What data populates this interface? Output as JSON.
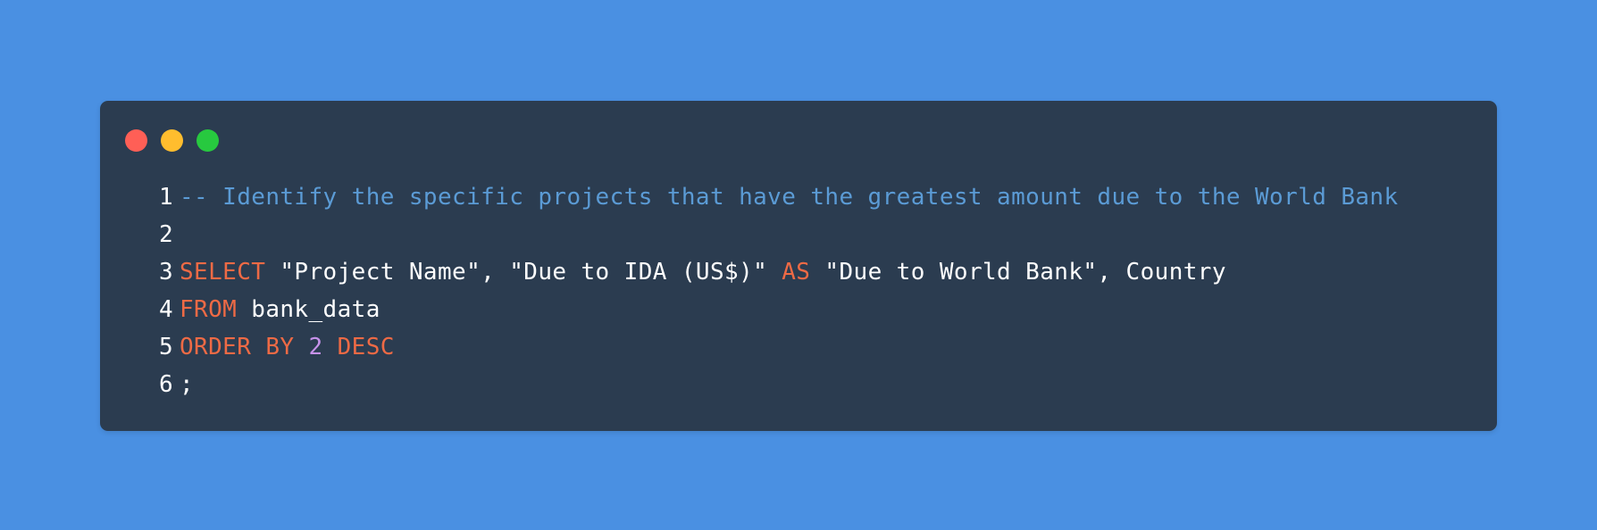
{
  "window": {
    "buttons": [
      "close-icon",
      "minimize-icon",
      "maximize-icon"
    ],
    "colors": {
      "background": "#4a90e2",
      "window": "#2b3c50",
      "close": "#ff5f56",
      "minimize": "#ffbd2e",
      "maximize": "#27c93f",
      "comment": "#5b9bd5",
      "keyword": "#ee6a45",
      "number": "#c792ea",
      "text": "#ffffff"
    }
  },
  "code": {
    "language": "sql",
    "lines": [
      {
        "num": "1",
        "tokens": [
          {
            "type": "comment",
            "text": "-- Identify the specific projects that have the greatest amount due to the World Bank"
          }
        ]
      },
      {
        "num": "2",
        "tokens": []
      },
      {
        "num": "3",
        "tokens": [
          {
            "type": "keyword",
            "text": "SELECT"
          },
          {
            "type": "text",
            "text": " \"Project Name\", \"Due to IDA (US$)\" "
          },
          {
            "type": "keyword",
            "text": "AS"
          },
          {
            "type": "text",
            "text": " \"Due to World Bank\", Country"
          }
        ]
      },
      {
        "num": "4",
        "tokens": [
          {
            "type": "keyword",
            "text": "FROM"
          },
          {
            "type": "text",
            "text": " bank_data"
          }
        ]
      },
      {
        "num": "5",
        "tokens": [
          {
            "type": "keyword",
            "text": "ORDER BY"
          },
          {
            "type": "text",
            "text": " "
          },
          {
            "type": "number",
            "text": "2"
          },
          {
            "type": "text",
            "text": " "
          },
          {
            "type": "keyword",
            "text": "DESC"
          }
        ]
      },
      {
        "num": "6",
        "tokens": [
          {
            "type": "text",
            "text": ";"
          }
        ]
      }
    ]
  }
}
